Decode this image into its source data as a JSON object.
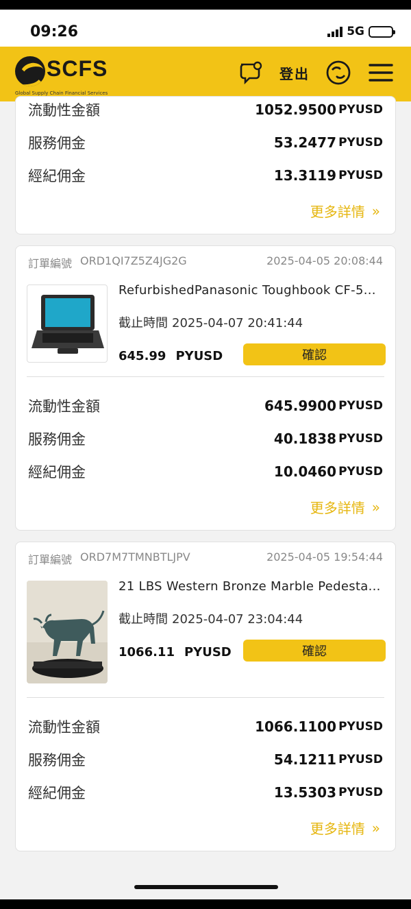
{
  "status": {
    "time": "09:26",
    "network": "5G"
  },
  "header": {
    "brand": "SCFS",
    "tagline": "Global Supply Chain Financial Services",
    "login_label": "登出",
    "icons": [
      "chat-icon",
      "language-icon",
      "menu-icon"
    ],
    "accent_color": "#f2c316"
  },
  "labels": {
    "liquidity": "流動性金額",
    "service_fee": "服務佣金",
    "broker_fee": "經紀佣金",
    "more": "更多詳情",
    "order_no": "訂單編號",
    "deadline": "截止時間",
    "confirm": "確認",
    "currency": "PYUSD"
  },
  "card0": {
    "liquidity": "1052.9500",
    "service_fee": "53.2477",
    "broker_fee": "13.3119"
  },
  "orders": [
    {
      "order_id": "ORD1QI7Z5Z4JG2G",
      "datetime": "2025-04-05 20:08:44",
      "product": "RefurbishedPanasonic Toughbook CF-5...",
      "deadline": "2025-04-07 20:41:44",
      "price": "645.99",
      "liquidity": "645.9900",
      "service_fee": "40.1838",
      "broker_fee": "10.0460",
      "thumb_icon": "laptop-image"
    },
    {
      "order_id": "ORD7M7TMNBTLJPV",
      "datetime": "2025-04-05 19:54:44",
      "product": "21 LBS Western Bronze Marble Pedesta...",
      "deadline": "2025-04-07 23:04:44",
      "price": "1066.11",
      "liquidity": "1066.1100",
      "service_fee": "54.1211",
      "broker_fee": "13.5303",
      "thumb_icon": "bronze-bull-image"
    }
  ]
}
